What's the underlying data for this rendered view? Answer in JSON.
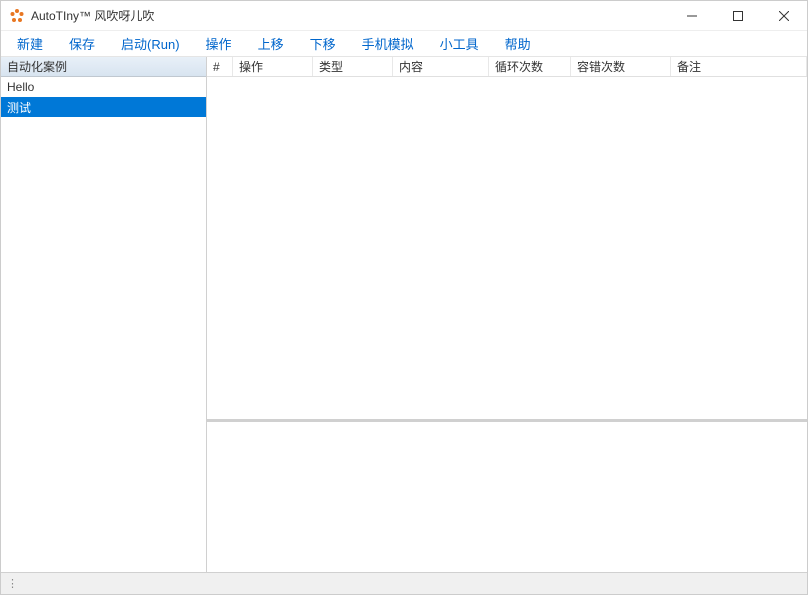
{
  "window": {
    "title": "AutoTIny™ 风吹呀儿吹"
  },
  "menu": {
    "items": [
      "新建",
      "保存",
      "启动(Run)",
      "操作",
      "上移",
      "下移",
      "手机模拟",
      "小工具",
      "帮助"
    ]
  },
  "sidebar": {
    "header": "自动化案例",
    "items": [
      {
        "label": "Hello",
        "selected": false
      },
      {
        "label": "测试",
        "selected": true
      }
    ]
  },
  "table": {
    "columns": [
      "#",
      "操作",
      "类型",
      "内容",
      "循环次数",
      "容错次数",
      "备注"
    ],
    "rows": []
  },
  "statusbar": {
    "text": ""
  }
}
